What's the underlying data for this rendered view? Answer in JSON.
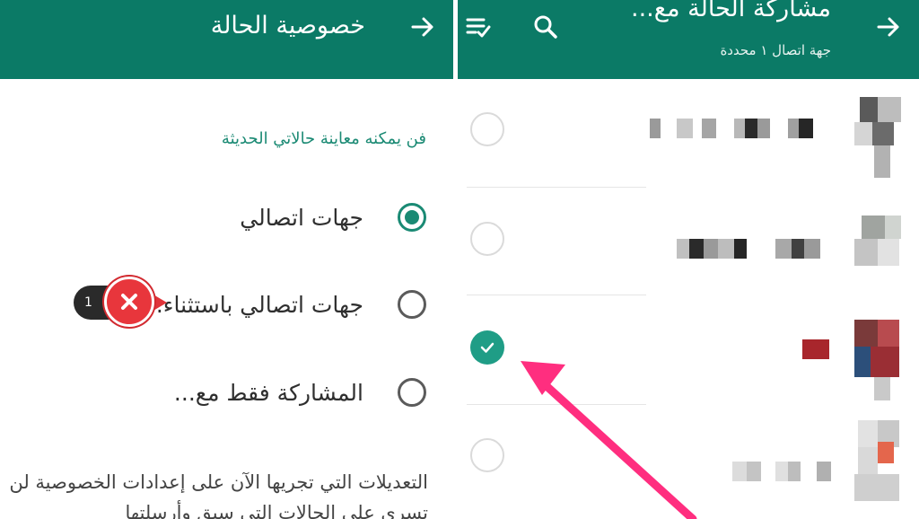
{
  "left_screen": {
    "header": {
      "title": "خصوصية الحالة",
      "back_icon": "arrow-right-icon"
    },
    "section_title": "فن يمكنه معاينة حالاتي الحديثة",
    "options": [
      {
        "label": "جهات اتصالي",
        "selected": true
      },
      {
        "label": "جهات اتصالي باستثناء...",
        "selected": false
      },
      {
        "label": "المشاركة فقط مع...",
        "selected": false
      }
    ],
    "note": "التعديلات التي تجريها الآن على إعدادات الخصوصية لن تسري على الحالات التي سبق وأرسلتها",
    "annotation": {
      "count": "1",
      "icon": "close-x-icon",
      "color": "#e8363c"
    }
  },
  "right_screen": {
    "header": {
      "title": "مشاركة الحالة مع...",
      "subtitle": "جهة اتصال ١ محددة",
      "icons": [
        "arrow-right-icon",
        "search-icon",
        "select-all-icon"
      ]
    },
    "contacts": [
      {
        "checked": false
      },
      {
        "checked": false
      },
      {
        "checked": true
      },
      {
        "checked": false
      }
    ],
    "annotation_arrow": {
      "color": "#ff2e7f"
    }
  },
  "colors": {
    "header": "#0b7a66",
    "accent": "#1a8a74",
    "check": "#1f9d86"
  }
}
